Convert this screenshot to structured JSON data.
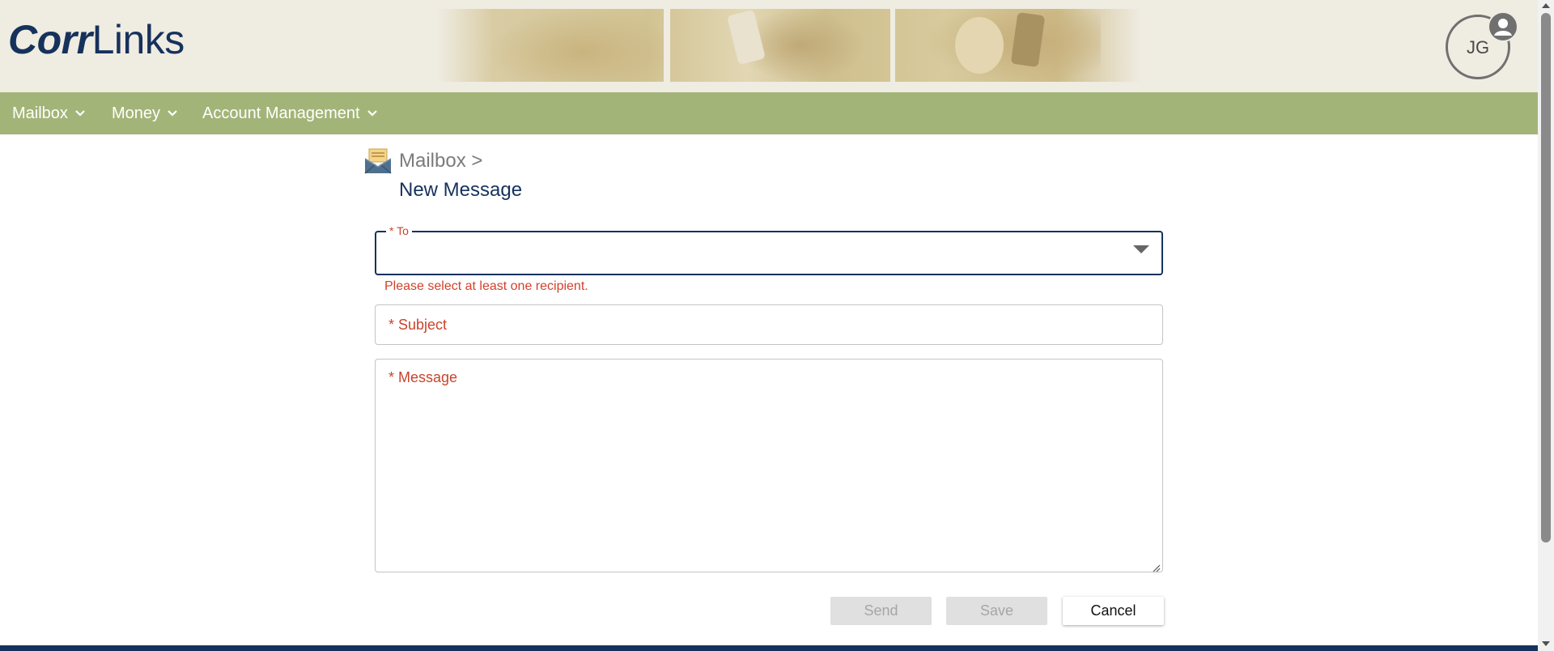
{
  "brand": {
    "logo_bold": "Corr",
    "logo_regular": "Links"
  },
  "user": {
    "initials": "JG"
  },
  "nav": {
    "items": [
      {
        "label": "Mailbox"
      },
      {
        "label": "Money"
      },
      {
        "label": "Account Management"
      }
    ]
  },
  "breadcrumb": {
    "parent": "Mailbox >",
    "current": "New Message"
  },
  "form": {
    "to": {
      "label": "* To",
      "value": "",
      "error": "Please select at least one recipient."
    },
    "subject": {
      "label": "* Subject",
      "value": ""
    },
    "message": {
      "label": "* Message",
      "value": ""
    }
  },
  "actions": {
    "send": "Send",
    "save": "Save",
    "cancel": "Cancel"
  },
  "colors": {
    "header_bg": "#efece2",
    "nav_bg": "#a3b478",
    "brand_navy": "#16325c",
    "required_label": "#c8442d",
    "error": "#d2412c"
  },
  "icons": {
    "nav_chevron": "chevron-down-icon",
    "user": "user-account-icon",
    "mailbox": "open-envelope-icon",
    "dropdown": "caret-down-icon"
  }
}
